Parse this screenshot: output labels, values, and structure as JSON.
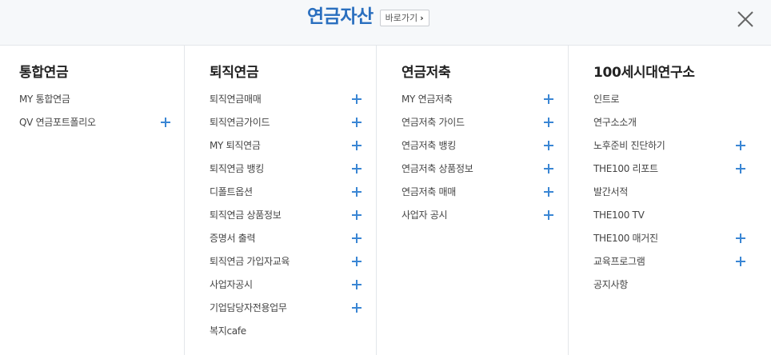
{
  "header": {
    "title": "연금자산",
    "goto_label": "바로가기",
    "goto_chevron": "›",
    "close_icon": "close-icon"
  },
  "columns": [
    {
      "title": "통합연금",
      "items": [
        {
          "label": "MY 통합연금",
          "expandable": false
        },
        {
          "label": "QV 연금포트폴리오",
          "expandable": true
        }
      ]
    },
    {
      "title": "퇴직연금",
      "items": [
        {
          "label": "퇴직연금매매",
          "expandable": true
        },
        {
          "label": "퇴직연금가이드",
          "expandable": true
        },
        {
          "label": "MY 퇴직연금",
          "expandable": true
        },
        {
          "label": "퇴직연금 뱅킹",
          "expandable": true
        },
        {
          "label": "디폴트옵션",
          "expandable": true
        },
        {
          "label": "퇴직연금 상품정보",
          "expandable": true
        },
        {
          "label": "증명서 출력",
          "expandable": true
        },
        {
          "label": "퇴직연금 가입자교육",
          "expandable": true
        },
        {
          "label": "사업자공시",
          "expandable": true
        },
        {
          "label": "기업담당자전용업무",
          "expandable": true
        },
        {
          "label": "복지cafe",
          "expandable": false
        }
      ]
    },
    {
      "title": "연금저축",
      "items": [
        {
          "label": "MY 연금저축",
          "expandable": true
        },
        {
          "label": "연금저축 가이드",
          "expandable": true
        },
        {
          "label": "연금저축 뱅킹",
          "expandable": true
        },
        {
          "label": "연금저축 상품정보",
          "expandable": true
        },
        {
          "label": "연금저축 매매",
          "expandable": true
        },
        {
          "label": "사업자 공시",
          "expandable": true
        }
      ]
    },
    {
      "title": "100세시대연구소",
      "items": [
        {
          "label": "인트로",
          "expandable": false
        },
        {
          "label": "연구소소개",
          "expandable": false
        },
        {
          "label": "노후준비 진단하기",
          "expandable": true
        },
        {
          "label": "THE100 리포트",
          "expandable": true
        },
        {
          "label": "발간서적",
          "expandable": false
        },
        {
          "label": "THE100 TV",
          "expandable": false
        },
        {
          "label": "THE100 매거진",
          "expandable": true
        },
        {
          "label": "교육프로그램",
          "expandable": true
        },
        {
          "label": "공지사항",
          "expandable": false
        }
      ]
    }
  ],
  "colors": {
    "title": "#2a6fbf",
    "plus": "#3a86d4",
    "header_bg": "#f6f8fa",
    "divider": "#e3e6ea"
  }
}
